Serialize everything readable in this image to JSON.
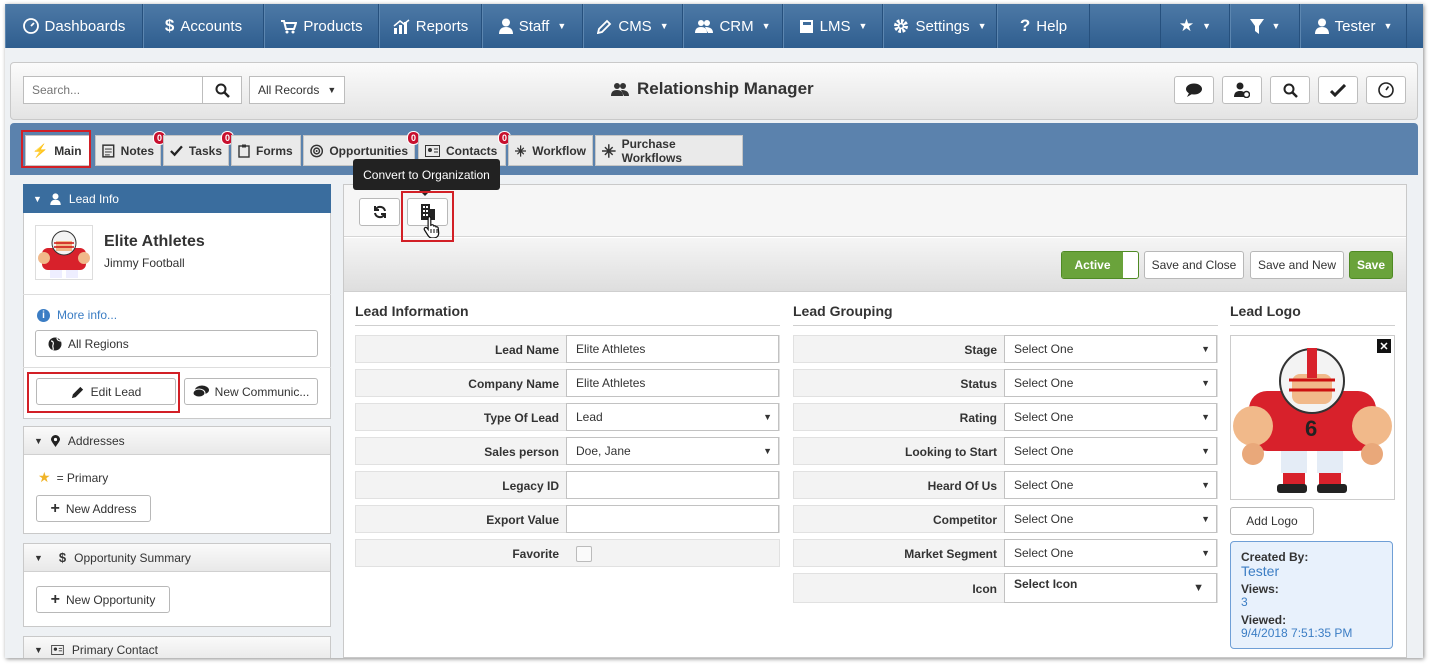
{
  "nav": {
    "items": [
      {
        "label": "Dashboards",
        "icon": "dashboard-icon"
      },
      {
        "label": "Accounts",
        "icon": "dollar-icon"
      },
      {
        "label": "Products",
        "icon": "cart-icon"
      },
      {
        "label": "Reports",
        "icon": "chart-icon"
      },
      {
        "label": "Staff",
        "icon": "user-icon"
      },
      {
        "label": "CMS",
        "icon": "pencil-icon"
      },
      {
        "label": "CRM",
        "icon": "users-icon"
      },
      {
        "label": "LMS",
        "icon": "book-icon"
      },
      {
        "label": "Settings",
        "icon": "gear-icon"
      },
      {
        "label": "Help",
        "icon": "question-icon"
      }
    ],
    "user": "Tester"
  },
  "header": {
    "search_placeholder": "Search...",
    "records_select": "All Records",
    "title": "Relationship Manager"
  },
  "tabs": [
    {
      "label": "Main"
    },
    {
      "label": "Notes",
      "badge": "0"
    },
    {
      "label": "Tasks",
      "badge": "0"
    },
    {
      "label": "Forms"
    },
    {
      "label": "Opportunities",
      "badge": "0"
    },
    {
      "label": "Contacts",
      "badge": "0"
    },
    {
      "label": "Workflow"
    },
    {
      "label": "Purchase Workflows"
    }
  ],
  "tooltip": "Convert to Organization",
  "lead_info": {
    "header": "Lead Info",
    "company": "Elite Athletes",
    "contact": "Jimmy Football",
    "more_info": "More info...",
    "regions": "All Regions",
    "edit_lead": "Edit Lead",
    "new_communication": "New Communic..."
  },
  "addresses": {
    "header": "Addresses",
    "primary_legend": "= Primary",
    "new_address": "New Address"
  },
  "opportunity_summary": {
    "header": "Opportunity Summary",
    "new_opportunity": "New Opportunity"
  },
  "primary_contact": {
    "header": "Primary Contact"
  },
  "actions": {
    "active_toggle": "Active",
    "save_close": "Save and Close",
    "save_new": "Save and New",
    "save": "Save"
  },
  "lead_information": {
    "title": "Lead Information",
    "fields": [
      {
        "label": "Lead Name",
        "value": "Elite Athletes"
      },
      {
        "label": "Company Name",
        "value": "Elite Athletes"
      },
      {
        "label": "Type Of Lead",
        "value": "Lead"
      },
      {
        "label": "Sales person",
        "value": "Doe, Jane"
      },
      {
        "label": "Legacy ID",
        "value": ""
      },
      {
        "label": "Export Value",
        "value": ""
      },
      {
        "label": "Favorite",
        "value": ""
      }
    ]
  },
  "lead_grouping": {
    "title": "Lead Grouping",
    "fields": [
      {
        "label": "Stage",
        "value": "Select One"
      },
      {
        "label": "Status",
        "value": "Select One"
      },
      {
        "label": "Rating",
        "value": "Select One"
      },
      {
        "label": "Looking to Start",
        "value": "Select One"
      },
      {
        "label": "Heard Of Us",
        "value": "Select One"
      },
      {
        "label": "Competitor",
        "value": "Select One"
      },
      {
        "label": "Market Segment",
        "value": "Select One"
      },
      {
        "label": "Icon",
        "value": "Select Icon"
      }
    ]
  },
  "lead_logo": {
    "title": "Lead Logo",
    "add_logo": "Add Logo",
    "created_by_label": "Created By:",
    "created_by": "Tester",
    "views_label": "Views:",
    "views": "3",
    "viewed_label": "Viewed:",
    "viewed": "9/4/2018 7:51:35 PM"
  },
  "colors": {
    "nav_blue": "#3a6a9b",
    "active_green": "#6aa33b",
    "highlight_red": "#d21f26",
    "badge_red": "#c8102e",
    "link_blue": "#3b7dc4"
  }
}
